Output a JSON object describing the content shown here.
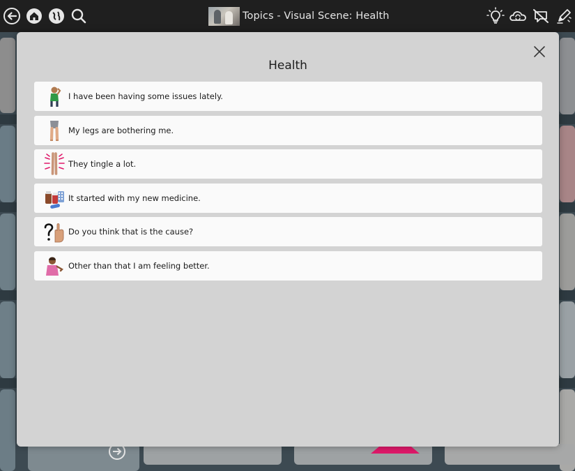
{
  "topbar": {
    "title": "Topics - Visual Scene: Health",
    "left_icons": [
      "back-icon",
      "home-icon",
      "globe-icon",
      "search-icon"
    ],
    "right_icons": [
      "lightbulb-icon",
      "cloud-sync-icon",
      "speech-off-icon",
      "edit-pencil-icon"
    ]
  },
  "modal": {
    "title": "Health",
    "close_icon": "close-icon",
    "phrases": [
      {
        "text": "I have been having some issues lately.",
        "symbol": "person-touching-head-icon"
      },
      {
        "text": "My legs are bothering me.",
        "symbol": "legs-icon"
      },
      {
        "text": "They tingle a lot.",
        "symbol": "tingling-legs-icon"
      },
      {
        "text": "It started with my new medicine.",
        "symbol": "medicine-icon"
      },
      {
        "text": "Do you think that is the cause?",
        "symbol": "question-hand-icon"
      },
      {
        "text": "Other than that I am feeling better.",
        "symbol": "happy-person-icon"
      }
    ]
  },
  "colors": {
    "topbar": "#1f1f1f",
    "modal_background": "#d3d3d3",
    "row_background": "#fafafa",
    "accent_pink": "#e0196a"
  }
}
